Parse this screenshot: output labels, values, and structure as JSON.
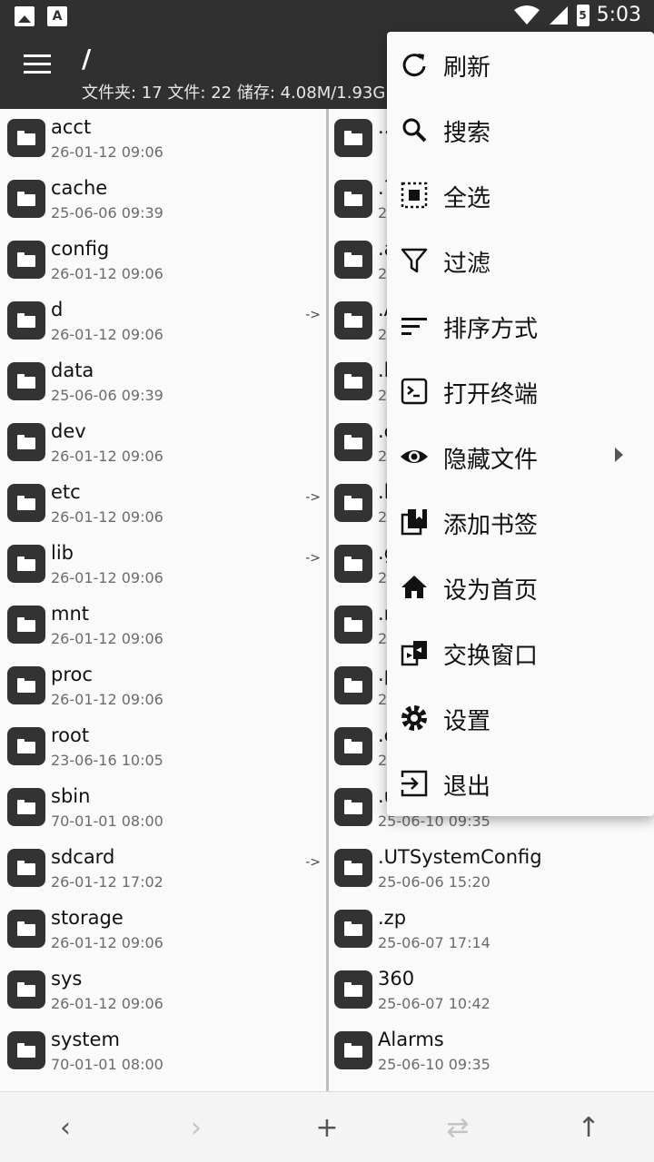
{
  "status_bar": {
    "time": "5:03",
    "battery": "5",
    "notif_icons": [
      "image-icon",
      "a-icon"
    ]
  },
  "app_bar": {
    "title": "/",
    "info": "文件夹: 17  文件: 22  储存: 4.08M/1.93G"
  },
  "left_pane": {
    "rows": [
      {
        "name": "acct",
        "date": "26-01-12 09:06",
        "link": ""
      },
      {
        "name": "cache",
        "date": "25-06-06 09:39",
        "link": ""
      },
      {
        "name": "config",
        "date": "26-01-12 09:06",
        "link": ""
      },
      {
        "name": "d",
        "date": "26-01-12 09:06",
        "link": "->"
      },
      {
        "name": "data",
        "date": "25-06-06 09:39",
        "link": ""
      },
      {
        "name": "dev",
        "date": "26-01-12 09:06",
        "link": ""
      },
      {
        "name": "etc",
        "date": "26-01-12 09:06",
        "link": "->"
      },
      {
        "name": "lib",
        "date": "26-01-12 09:06",
        "link": "->"
      },
      {
        "name": "mnt",
        "date": "26-01-12 09:06",
        "link": ""
      },
      {
        "name": "proc",
        "date": "26-01-12 09:06",
        "link": ""
      },
      {
        "name": "root",
        "date": "23-06-16 10:05",
        "link": ""
      },
      {
        "name": "sbin",
        "date": "70-01-01 08:00",
        "link": ""
      },
      {
        "name": "sdcard",
        "date": "26-01-12 17:02",
        "link": "->"
      },
      {
        "name": "storage",
        "date": "26-01-12 09:06",
        "link": ""
      },
      {
        "name": "sys",
        "date": "26-01-12 09:06",
        "link": ""
      },
      {
        "name": "system",
        "date": "70-01-01 08:00",
        "link": ""
      }
    ]
  },
  "right_pane": {
    "rows": [
      {
        "name": "..",
        "date": ""
      },
      {
        "name": ".7",
        "date": "2"
      },
      {
        "name": ".a",
        "date": "2"
      },
      {
        "name": ".A",
        "date": "2"
      },
      {
        "name": ".b",
        "date": "2"
      },
      {
        "name": ".c",
        "date": "2"
      },
      {
        "name": ".l",
        "date": "2"
      },
      {
        "name": ".g",
        "date": "2"
      },
      {
        "name": ".n",
        "date": "2"
      },
      {
        "name": ".p",
        "date": "2"
      },
      {
        "name": ".c",
        "date": "2"
      },
      {
        "name": ".u",
        "date": "25-06-10 09:35"
      },
      {
        "name": ".UTSystemConfig",
        "date": "25-06-06 15:20"
      },
      {
        "name": ".zp",
        "date": "25-06-07 17:14"
      },
      {
        "name": "360",
        "date": "25-06-07 10:42"
      },
      {
        "name": "Alarms",
        "date": "25-06-10 09:35"
      }
    ]
  },
  "menu": {
    "items": [
      {
        "label": "刷新",
        "icon": "refresh-icon"
      },
      {
        "label": "搜索",
        "icon": "search-icon"
      },
      {
        "label": "全选",
        "icon": "select-all-icon"
      },
      {
        "label": "过滤",
        "icon": "filter-icon"
      },
      {
        "label": "排序方式",
        "icon": "sort-icon"
      },
      {
        "label": "打开终端",
        "icon": "terminal-icon"
      },
      {
        "label": "隐藏文件",
        "icon": "eye-icon"
      },
      {
        "label": "添加书签",
        "icon": "bookmark-icon"
      },
      {
        "label": "设为首页",
        "icon": "home-icon"
      },
      {
        "label": "交换窗口",
        "icon": "swap-window-icon"
      },
      {
        "label": "设置",
        "icon": "gear-icon"
      },
      {
        "label": "退出",
        "icon": "exit-icon"
      }
    ]
  },
  "bottom_nav": {
    "back": "‹",
    "forward": "›",
    "add": "+",
    "swap": "⇄",
    "up": "↑"
  },
  "colors": {
    "app_bar": "#303030",
    "folder_icon": "#333333",
    "menu_bg": "#fafafa"
  }
}
